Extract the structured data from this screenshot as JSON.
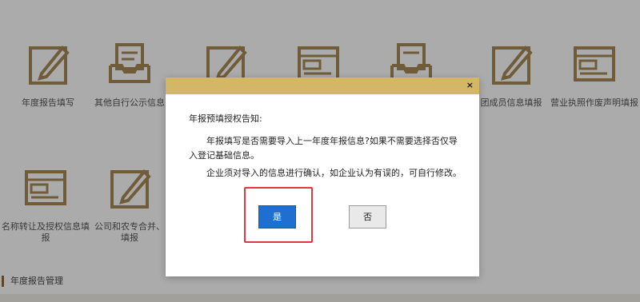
{
  "tiles_top": [
    {
      "label": "年度报告填写",
      "icon": "edit-icon"
    },
    {
      "label": "其他自行公示信息",
      "icon": "inbox-icon"
    },
    {
      "label": "",
      "icon": "edit-icon"
    },
    {
      "label": "",
      "icon": "form-icon"
    },
    {
      "label": "",
      "icon": "inbox-icon"
    },
    {
      "label": "团成员信息填报",
      "icon": "edit-icon"
    },
    {
      "label": "营业执照作废声明填报",
      "icon": "form-icon"
    }
  ],
  "tiles_bottom": [
    {
      "label_line1": "名称转让及授权信息填",
      "label_line2": "报",
      "icon": "form-icon"
    },
    {
      "label_line1": "公司和农专合并、",
      "label_line2": "填报",
      "icon": "edit-icon"
    }
  ],
  "section_title": "年度报告管理",
  "dialog": {
    "close_label": "×",
    "title": "年报预填授权告知:",
    "paragraph1": "年报填写是否需要导入上一年度年报信息?如果不需要选择否仅导入登记基础信息。",
    "paragraph2": "企业须对导入的信息进行确认，如企业认为有误的，可自行修改。",
    "yes_label": "是",
    "no_label": "否"
  },
  "colors": {
    "dialog_header": "#d4b766",
    "yes_button": "#1f6fd1",
    "highlight": "#e0383e",
    "icon_gold": "#a88a56"
  }
}
